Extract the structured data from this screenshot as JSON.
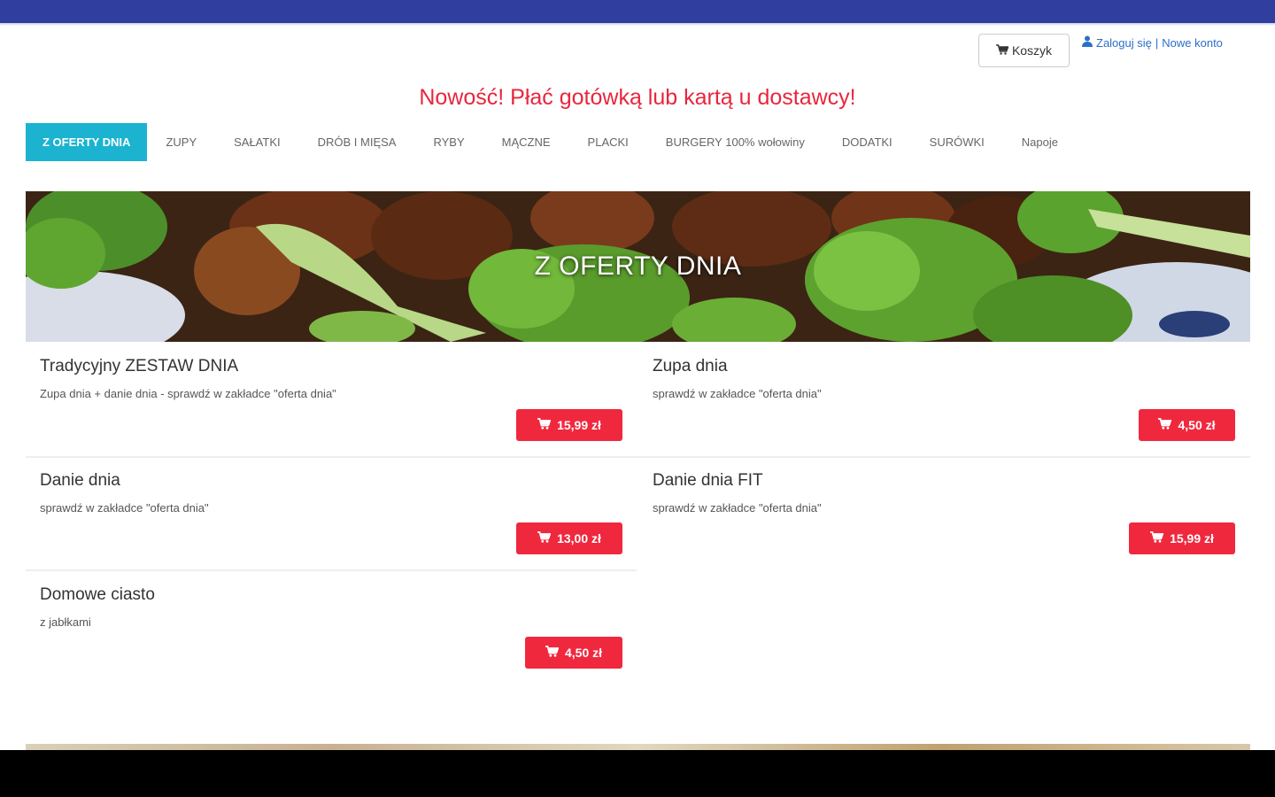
{
  "header": {
    "cart_label": "Koszyk",
    "login_label": "Zaloguj się",
    "separator": "|",
    "register_label": "Nowe konto"
  },
  "promo": "Nowość! Płać gotówką lub kartą u dostawcy!",
  "nav": {
    "items": [
      {
        "label": "Z OFERTY DNIA"
      },
      {
        "label": "ZUPY"
      },
      {
        "label": "SAŁATKI"
      },
      {
        "label": "DRÓB I MIĘSA"
      },
      {
        "label": "RYBY"
      },
      {
        "label": "MĄCZNE"
      },
      {
        "label": "PLACKI"
      },
      {
        "label": "BURGERY 100% wołowiny"
      },
      {
        "label": "DODATKI"
      },
      {
        "label": "SURÓWKI"
      },
      {
        "label": "Napoje"
      }
    ],
    "active_index": 0
  },
  "hero": {
    "title": "Z OFERTY DNIA"
  },
  "items": [
    {
      "name": "Tradycyjny ZESTAW DNIA",
      "description": "Zupa dnia + danie dnia - sprawdź w zakładce \"oferta dnia\"",
      "price": "15,99 zł"
    },
    {
      "name": "Zupa dnia",
      "description": "sprawdź w zakładce \"oferta dnia\"",
      "price": "4,50 zł"
    },
    {
      "name": "Danie dnia",
      "description": "sprawdź w zakładce \"oferta dnia\"",
      "price": "13,00 zł"
    },
    {
      "name": "Danie dnia FIT",
      "description": "sprawdź w zakładce \"oferta dnia\"",
      "price": "15,99 zł"
    },
    {
      "name": "Domowe ciasto",
      "description": "z jabłkami",
      "price": "4,50 zł"
    }
  ],
  "colors": {
    "status_bar": "#303f9f",
    "promo_text": "#e8263c",
    "nav_active": "#1cb3d1",
    "price_button": "#f0283e",
    "link": "#2a6fc9"
  },
  "icons": {
    "cart": "cart-icon",
    "user": "user-icon"
  }
}
